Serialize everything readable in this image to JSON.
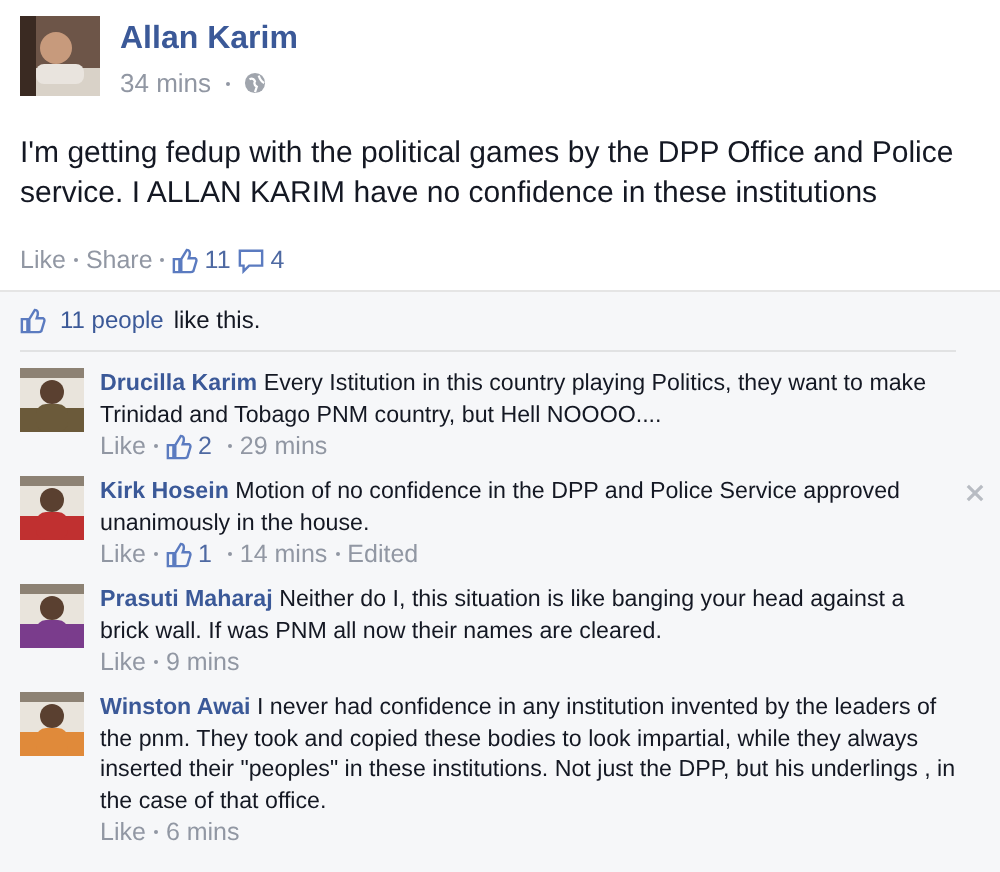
{
  "post": {
    "author": "Allan Karim",
    "time": "34 mins",
    "text": "I'm getting fedup with the political games by the DPP Office and Police service. I ALLAN KARIM have no confidence in these institutions",
    "actions": [
      "Like",
      "Share"
    ],
    "like_count": "11",
    "comment_count": "4"
  },
  "likes_summary": {
    "count_link": "11 people",
    "rest": "like this."
  },
  "comments": [
    {
      "author": "Drucilla Karim",
      "text": "Every Istitution in this country playing Politics, they want to make Trinidad and Tobago PNM country, but Hell NOOOO....",
      "like_label": "Like",
      "likes": "2",
      "time": "29 mins",
      "close": false
    },
    {
      "author": "Kirk Hosein",
      "text": "Motion of no confidence in the DPP and Police Service approved unanimously in the house.",
      "like_label": "Like",
      "likes": "1",
      "time": "14 mins",
      "edited": "Edited",
      "close": true
    },
    {
      "author": "Prasuti Maharaj",
      "text": "Neither do I, this situation is like banging your head against a brick wall. If was PNM all now their names are cleared.",
      "like_label": "Like",
      "time": "9 mins",
      "close": false
    },
    {
      "author": "Winston Awai",
      "text": "I never had confidence in any institution invented by the leaders of the pnm. They took and copied these bodies to look impartial, while they always inserted their \"peoples\" in these institutions. Not just the DPP, but his underlings , in the case of that office.",
      "like_label": "Like",
      "time": "6 mins",
      "close": false
    }
  ]
}
